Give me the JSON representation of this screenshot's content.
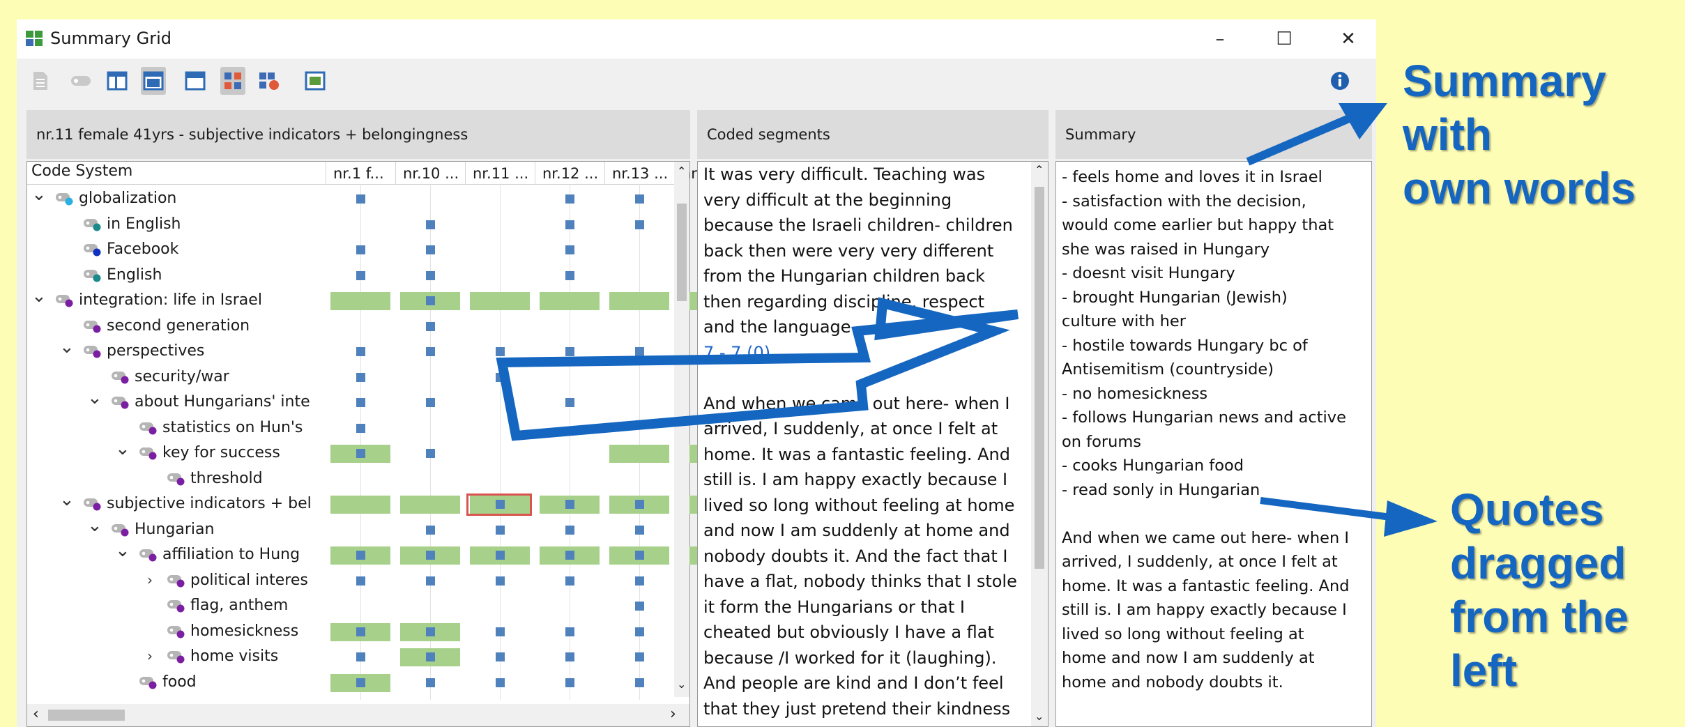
{
  "window": {
    "title": "Summary Grid",
    "controls": {
      "minimize": "–",
      "maximize": "☐",
      "close": "✕"
    }
  },
  "toolbar": {
    "icons": [
      "document-icon",
      "tag-icon",
      "layout-top-icon",
      "layout-middle-icon",
      "layout-full-icon",
      "grid-active-icon",
      "grid-settings-icon",
      "export-icon"
    ],
    "info_icon": "info-icon"
  },
  "left_pane": {
    "header": "nr.11 female 41yrs - subjective indicators + belongingness",
    "code_system_label": "Code System",
    "columns": [
      "nr.1 f...",
      "nr.10 ...",
      "nr.11 ...",
      "nr.12 ...",
      "nr.13 ...",
      "nr"
    ],
    "rows": [
      {
        "label": "globalization",
        "indent": 0,
        "expand": "open",
        "dot": "#2bb0e3",
        "cells": [
          "sq",
          "",
          "",
          "sq",
          "sq",
          ""
        ]
      },
      {
        "label": "in English",
        "indent": 1,
        "expand": "",
        "dot": "#1a8a8a",
        "cells": [
          "",
          "sq",
          "",
          "sq",
          "sq",
          ""
        ]
      },
      {
        "label": "Facebook",
        "indent": 1,
        "expand": "",
        "dot": "#1030c0",
        "cells": [
          "sq",
          "sq",
          "",
          "sq",
          "",
          ""
        ]
      },
      {
        "label": "English",
        "indent": 1,
        "expand": "",
        "dot": "#1a8a8a",
        "cells": [
          "sq",
          "sq",
          "",
          "sq",
          "",
          ""
        ]
      },
      {
        "label": "integration: life in Israel",
        "indent": 0,
        "expand": "open",
        "dot": "#7b1fa2",
        "cells": [
          "bar",
          "barsq",
          "bar",
          "bar",
          "bar",
          "bar"
        ]
      },
      {
        "label": "second generation",
        "indent": 1,
        "expand": "",
        "dot": "#7b1fa2",
        "cells": [
          "",
          "sq",
          "",
          "",
          "",
          ""
        ]
      },
      {
        "label": "perspectives",
        "indent": 1,
        "expand": "open",
        "dot": "#7b1fa2",
        "cells": [
          "sq",
          "sq",
          "sq",
          "sq",
          "sq",
          ""
        ]
      },
      {
        "label": "security/war",
        "indent": 2,
        "expand": "",
        "dot": "#7b1fa2",
        "cells": [
          "sq",
          "",
          "sq",
          "",
          "",
          ""
        ]
      },
      {
        "label": "about Hungarians' inte",
        "indent": 2,
        "expand": "open",
        "dot": "#7b1fa2",
        "cells": [
          "sq",
          "sq",
          "",
          "sq",
          "",
          ""
        ]
      },
      {
        "label": "statistics on Hun's",
        "indent": 3,
        "expand": "",
        "dot": "#7b1fa2",
        "cells": [
          "sq",
          "",
          "",
          "",
          "",
          ""
        ]
      },
      {
        "label": "key for success",
        "indent": 3,
        "expand": "open",
        "dot": "#7b1fa2",
        "cells": [
          "barsq",
          "sq",
          "",
          "",
          "bar",
          "bar"
        ]
      },
      {
        "label": "threshold",
        "indent": 4,
        "expand": "",
        "dot": "#7b1fa2",
        "cells": [
          "",
          "",
          "",
          "",
          "",
          ""
        ]
      },
      {
        "label": "subjective indicators + bel",
        "indent": 1,
        "expand": "open",
        "dot": "#7b1fa2",
        "cells": [
          "bar",
          "bar",
          "selsq",
          "barsq",
          "barsq",
          "bar"
        ]
      },
      {
        "label": "Hungarian",
        "indent": 2,
        "expand": "open",
        "dot": "#7b1fa2",
        "cells": [
          "",
          "sq",
          "sq",
          "sq",
          "sq",
          ""
        ]
      },
      {
        "label": "affiliation to Hung",
        "indent": 3,
        "expand": "open",
        "dot": "#7b1fa2",
        "cells": [
          "barsq",
          "barsq",
          "barsq",
          "barsq",
          "barsq",
          "bar"
        ]
      },
      {
        "label": "political interes",
        "indent": 4,
        "expand": "closed",
        "dot": "#7b1fa2",
        "cells": [
          "sq",
          "sq",
          "sq",
          "sq",
          "sq",
          ""
        ]
      },
      {
        "label": "flag, anthem",
        "indent": 4,
        "expand": "",
        "dot": "#7b1fa2",
        "cells": [
          "",
          "",
          "",
          "",
          "sq",
          ""
        ]
      },
      {
        "label": "homesickness",
        "indent": 4,
        "expand": "",
        "dot": "#7b1fa2",
        "cells": [
          "barsq",
          "barsq",
          "sq",
          "sq",
          "sq",
          ""
        ]
      },
      {
        "label": "home visits",
        "indent": 4,
        "expand": "closed",
        "dot": "#7b1fa2",
        "cells": [
          "sq",
          "barsq",
          "sq",
          "sq",
          "sq",
          ""
        ]
      },
      {
        "label": "food",
        "indent": 3,
        "expand": "",
        "dot": "#7b1fa2",
        "cells": [
          "barsq",
          "sq",
          "sq",
          "sq",
          "sq",
          ""
        ]
      }
    ]
  },
  "middle_pane": {
    "header": "Coded segments",
    "segments": [
      {
        "lines": [
          "It was very difficult. Teaching was",
          "very difficult at the beginning",
          "because the Israeli children- children",
          "back then were very very different",
          "from the Hungarian children back",
          "then regarding discipline, respect",
          "and the language."
        ],
        "ref": "7 - 7 (0)"
      },
      {
        "lines": [
          "And when we came out here- when I",
          "arrived, I suddenly, at once I felt at",
          "home. It was a fantastic feeling. And",
          "still is. I am happy exactly because I",
          "lived so long without feeling at home",
          "and now I am suddenly at home and",
          "nobody doubts it. And the fact that I",
          "have a flat, nobody thinks that I stole",
          "it form the Hungarians or that I",
          "cheated but obviously I have a flat",
          "because /I worked for it (laughing).",
          "And people are kind and I don’t feel",
          "that they just pretend their kindness"
        ],
        "ref": ""
      }
    ]
  },
  "right_pane": {
    "header": "Summary",
    "lines": [
      "- feels home and loves it in Israel",
      "- satisfaction with the decision,",
      "would come earlier but happy that",
      "she was raised in Hungary",
      "- doesnt visit Hungary",
      "- brought Hungarian (Jewish)",
      "culture with her",
      "- hostile towards Hungary bc of",
      "Antisemitism (countryside)",
      "- no homesickness",
      "- follows Hungarian news and active",
      "on forums",
      "- cooks Hungarian food",
      "- read sonly in Hungarian",
      "",
      "And when we came out here- when I",
      "arrived, I suddenly, at once I felt at",
      "home. It was a fantastic feeling. And",
      "still is. I am happy exactly because I",
      "lived so long without feeling at",
      "home and now I am suddenly at",
      "home and nobody doubts it."
    ]
  },
  "annotations": {
    "summary_callout": [
      "Summary with",
      "own words"
    ],
    "quotes_callout": [
      "Quotes",
      "dragged",
      "from the left"
    ],
    "arrow_color": "#1466c0"
  }
}
